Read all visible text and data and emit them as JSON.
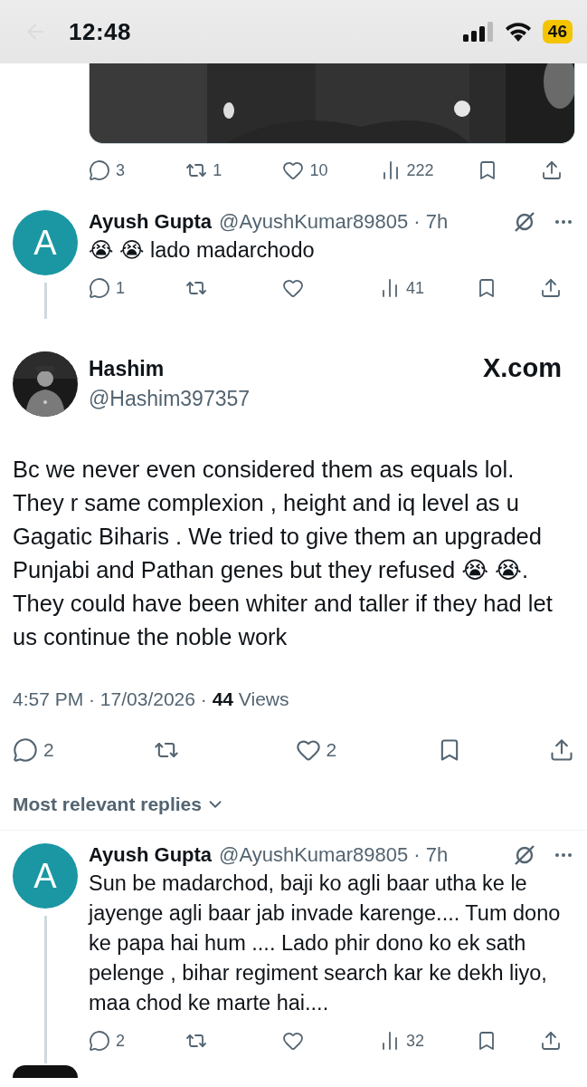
{
  "status_bar": {
    "time": "12:48",
    "battery": "46"
  },
  "parent_post": {
    "actions": [
      {
        "kind": "reply",
        "count": "3"
      },
      {
        "kind": "repost",
        "count": "1"
      },
      {
        "kind": "like",
        "count": "10"
      },
      {
        "kind": "views",
        "count": "222"
      },
      {
        "kind": "bookmark"
      },
      {
        "kind": "share"
      }
    ]
  },
  "thread_reply": {
    "avatar_letter": "A",
    "name": "Ayush Gupta",
    "meta": "@AyushKumar89805 · 7h",
    "text": "😭 😭 lado madarchodo",
    "actions": [
      {
        "kind": "reply",
        "count": "1"
      },
      {
        "kind": "repost"
      },
      {
        "kind": "like"
      },
      {
        "kind": "views",
        "count": "41"
      },
      {
        "kind": "bookmark"
      },
      {
        "kind": "share"
      }
    ]
  },
  "main_post": {
    "name": "Hashim",
    "handle": "@Hashim397357",
    "source": "X.com",
    "text": "Bc we never even considered them as equals lol. They r same complexion , height and iq level as u Gagatic Biharis . We tried to give them an upgraded Punjabi and Pathan genes but they refused 😭 😭. They could have been whiter and taller if they had let us continue the noble work",
    "meta": "4:57 PM · 17/03/2026 · **44** Views",
    "actions": [
      {
        "kind": "reply",
        "count": "2"
      },
      {
        "kind": "repost"
      },
      {
        "kind": "like",
        "count": "2"
      },
      {
        "kind": "bookmark"
      },
      {
        "kind": "share"
      }
    ]
  },
  "replies_filter": {
    "label": "Most relevant replies"
  },
  "replies": [
    {
      "avatar_letter": "A",
      "name": "Ayush Gupta",
      "meta": "@AyushKumar89805 · 7h",
      "text": "Sun be madarchod, baji  ko agli baar utha ke le jayenge agli baar jab invade karenge.... Tum dono ke papa hai hum .... Lado phir dono ko ek sath pelenge , bihar regiment search kar ke dekh liyo, maa chod ke marte hai....",
      "actions": [
        {
          "kind": "reply",
          "count": "2"
        },
        {
          "kind": "repost"
        },
        {
          "kind": "like"
        },
        {
          "kind": "views",
          "count": "32"
        },
        {
          "kind": "bookmark"
        },
        {
          "kind": "share"
        }
      ]
    }
  ]
}
